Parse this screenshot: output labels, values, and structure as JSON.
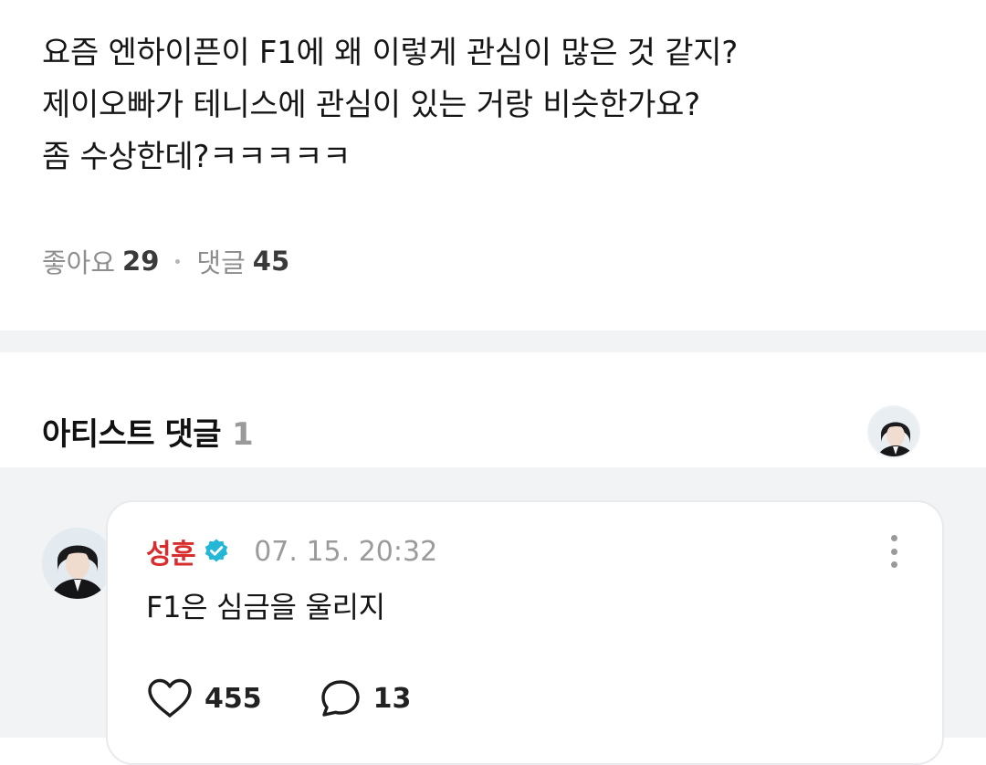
{
  "post": {
    "lines": [
      "요즘 엔하이픈이 F1에 왜 이렇게 관심이 많은 것 같지?",
      "제이오빠가 테니스에 관심이 있는 거랑 비슷한가요?",
      "좀 수상한데?ㅋㅋㅋㅋㅋ"
    ],
    "likes_label": "좋아요",
    "likes_count": "29",
    "comments_label": "댓글",
    "comments_count": "45"
  },
  "artist_comments": {
    "title": "아티스트 댓글",
    "count": "1",
    "header_avatar_icon": "artist-avatar"
  },
  "comment": {
    "author": "성훈",
    "verified_icon": "verified-badge-icon",
    "time": "07. 15. 20:32",
    "text": "F1은 심금을 울리지",
    "like_icon": "heart-icon",
    "like_count": "455",
    "reply_icon": "speech-bubble-icon",
    "reply_count": "13",
    "more_icon": "more-vertical-icon"
  },
  "colors": {
    "author_name": "#d92d2d",
    "verified_badge": "#25b8d6",
    "divider_band": "#f2f3f5"
  }
}
